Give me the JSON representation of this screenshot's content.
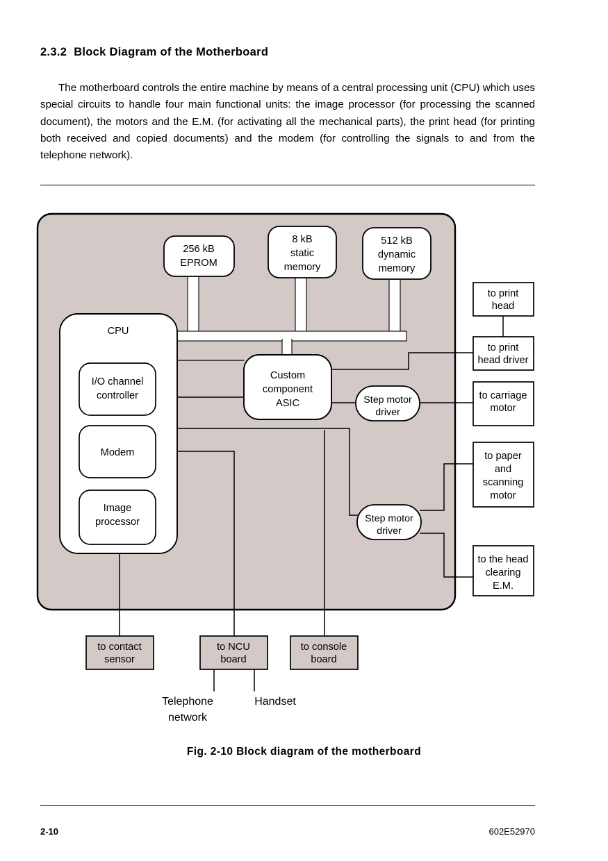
{
  "document": {
    "heading_number": "2.3.2",
    "heading_text": "Block Diagram of the Motherboard",
    "paragraph": "The motherboard controls the entire machine by means of a central processing unit (CPU) which uses special circuits to handle four main functional units: the image processor (for processing the scanned document), the motors and the E.M. (for activating all the mechanical parts), the print head (for printing both received and copied documents) and the modem (for controlling the signals to and from the telephone network).",
    "figure_caption": "Fig. 2-10 Block diagram of the motherboard",
    "footer_page": "2-10",
    "footer_code": "602E52970"
  },
  "colors": {
    "board_fill": "#d3c9c7",
    "block_fill": "#ffffff",
    "line": "#000000",
    "page_bg": "#ffffff"
  },
  "diagram": {
    "memory_blocks": [
      {
        "id": "eprom",
        "line1": "256 kB",
        "line2": "EPROM",
        "line3": ""
      },
      {
        "id": "static-memory",
        "line1": "8 kB",
        "line2": "static",
        "line3": "memory"
      },
      {
        "id": "dynamic-memory",
        "line1": "512 kB",
        "line2": "dynamic",
        "line3": "memory"
      }
    ],
    "cpu": {
      "title": "CPU",
      "sub_blocks": [
        {
          "id": "io-channel-controller",
          "line1": "I/O channel",
          "line2": "controller"
        },
        {
          "id": "modem",
          "line1": "Modem",
          "line2": ""
        },
        {
          "id": "image-processor",
          "line1": "Image",
          "line2": "processor"
        }
      ]
    },
    "asic": {
      "line1": "Custom",
      "line2": "component",
      "line3": "ASIC"
    },
    "step_motor_drivers": [
      {
        "id": "step-motor-driver-1",
        "line1": "Step motor",
        "line2": "driver"
      },
      {
        "id": "step-motor-driver-2",
        "line1": "Step motor",
        "line2": "driver"
      }
    ],
    "right_connectors": [
      {
        "id": "to-print-head",
        "lines": [
          "to print",
          "head"
        ]
      },
      {
        "id": "to-print-head-driver",
        "lines": [
          "to print",
          "head driver"
        ]
      },
      {
        "id": "to-carriage-motor",
        "lines": [
          "to carriage",
          "motor"
        ]
      },
      {
        "id": "to-paper-scan-motor",
        "lines": [
          "to paper",
          "and",
          "scanning",
          "motor"
        ]
      },
      {
        "id": "to-head-clearing-em",
        "lines": [
          "to the head",
          "clearing",
          "E.M."
        ]
      }
    ],
    "bottom_connectors": [
      {
        "id": "to-contact-sensor",
        "lines": [
          "to contact",
          "sensor"
        ]
      },
      {
        "id": "to-ncu-board",
        "lines": [
          "to NCU",
          "board"
        ]
      },
      {
        "id": "to-console-board",
        "lines": [
          "to console",
          "board"
        ]
      }
    ],
    "external_labels": [
      {
        "id": "telephone-network",
        "line1": "Telephone",
        "line2": "network"
      },
      {
        "id": "handset",
        "line1": "Handset",
        "line2": ""
      }
    ]
  }
}
